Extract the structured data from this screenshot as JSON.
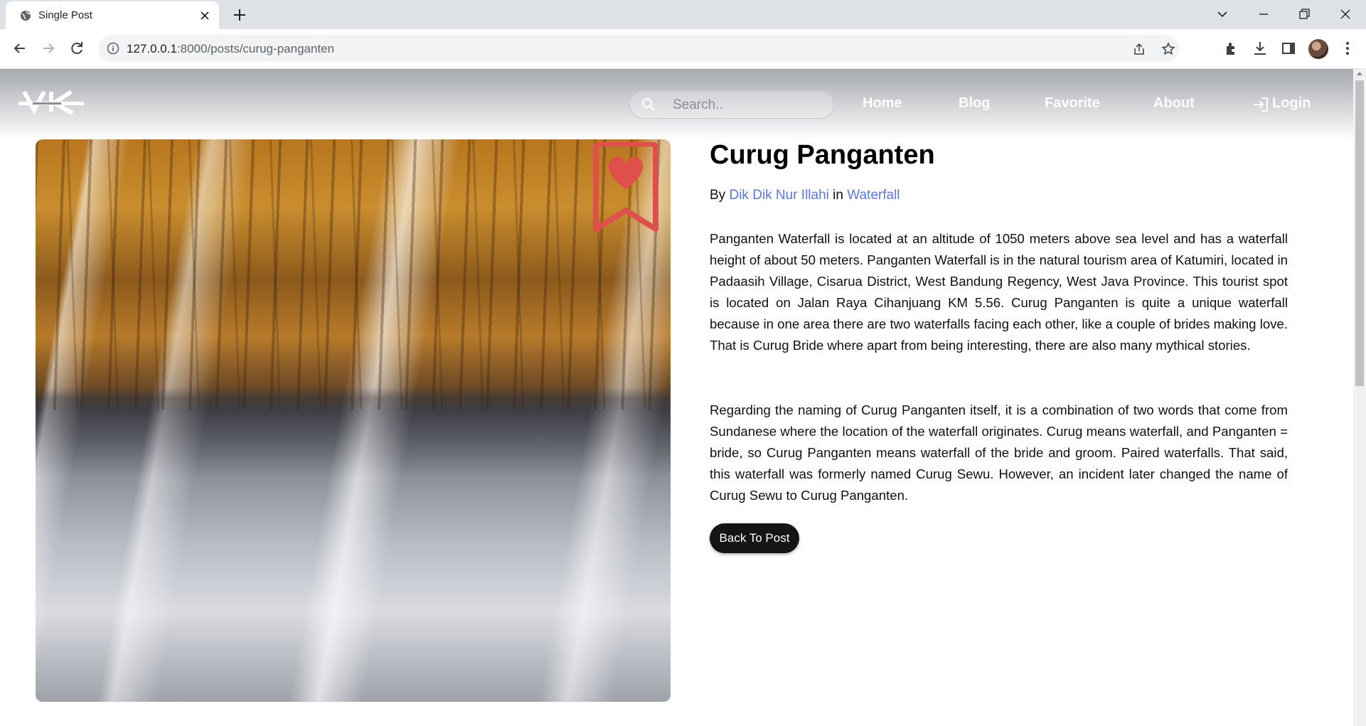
{
  "browser": {
    "tab_title": "Single Post",
    "url_host": "127.0.0.1",
    "url_rest": ":8000/posts/curug-panganten"
  },
  "site": {
    "logo_text": "VK",
    "search_placeholder": "Search..",
    "nav": {
      "home": "Home",
      "blog": "Blog",
      "favorite": "Favorite",
      "about": "About",
      "login": "Login"
    }
  },
  "post": {
    "title": "Curug Panganten",
    "by_label": "By",
    "author": "Dik Dik Nur Illahi",
    "in_label": "in",
    "category": "Waterfall",
    "paragraph1": "Panganten Waterfall is located at an altitude of 1050 meters above sea level and has a waterfall height of about 50 meters. Panganten Waterfall is in the natural tourism area of  Katumiri, located in Padaasih Village, Cisarua District, West Bandung Regency, West Java Province. This tourist spot is located on Jalan Raya Cihanjuang KM 5.56. Curug Panganten is quite a unique waterfall because in one area there are two waterfalls facing each other, like a couple of brides making love. That is Curug Bride where apart from being interesting, there are also many mythical stories.",
    "paragraph2": "Regarding the naming of Curug Panganten itself, it is a combination of two words that come from Sundanese where the location of the waterfall originates. Curug means waterfall, and Panganten = bride, so Curug Panganten means waterfall of the bride and groom. Paired waterfalls. That said, this waterfall was formerly named Curug Sewu. However, an incident later changed the name of Curug Sewu to Curug Panganten.",
    "back_label": "Back To Post"
  },
  "colors": {
    "link": "#5a77e8",
    "bookmark": "#e0504a",
    "button_bg": "#151515"
  }
}
